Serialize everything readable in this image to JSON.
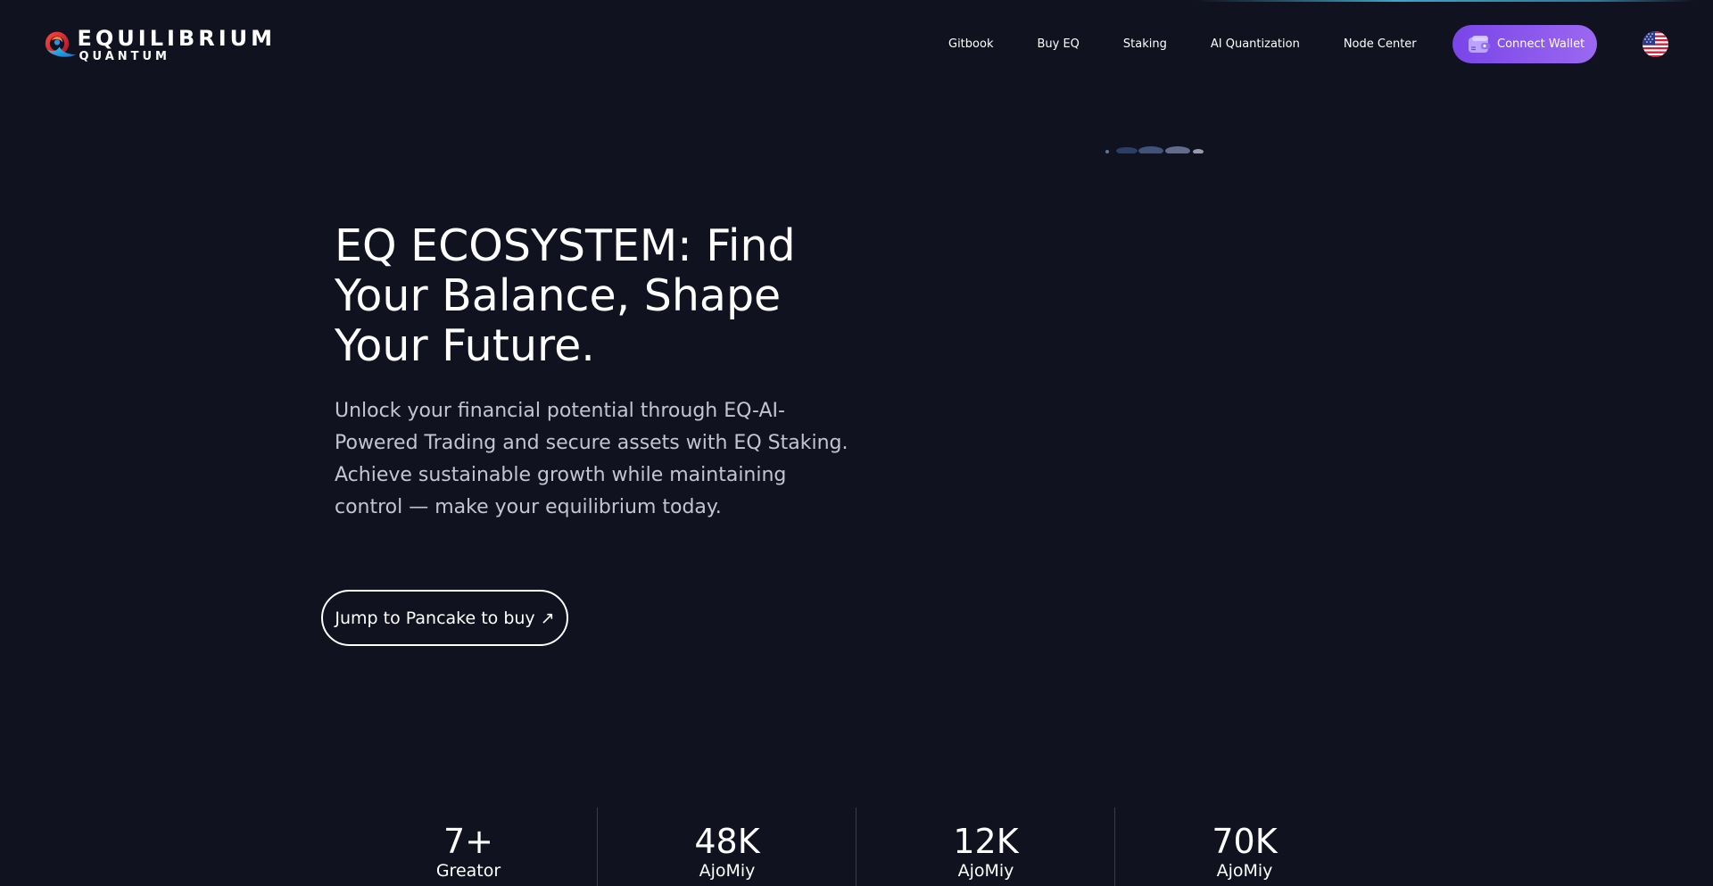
{
  "brand": {
    "name": "EQUILIBRIUM",
    "tagline": "QUANTUM"
  },
  "nav": {
    "items": [
      {
        "label": "Gitbook"
      },
      {
        "label": "Buy EQ"
      },
      {
        "label": "Staking"
      },
      {
        "label": "AI Quantization"
      },
      {
        "label": "Node Center"
      }
    ],
    "connect_label": "Connect Wallet",
    "language_icon": "us-flag-icon"
  },
  "hero": {
    "title": "EQ ECOSYSTEM: Find Your Balance, Shape Your Future.",
    "description": "Unlock your financial potential through EQ-AI-Powered Trading and secure assets with EQ Staking. Achieve sustainable growth while maintaining control — make your equilibrium today.",
    "cta_label": "Jump to Pancake to buy",
    "cta_icon": "↗"
  },
  "stats": [
    {
      "value": "7+",
      "label": "Greator"
    },
    {
      "value": "48K",
      "label": "AjoMiy"
    },
    {
      "value": "12K",
      "label": "AjoMiy"
    },
    {
      "value": "70K",
      "label": "AjoMiy"
    }
  ],
  "colors": {
    "background": "#11121f",
    "accent": "#8a55ec",
    "text_muted": "#c3c5d2"
  }
}
